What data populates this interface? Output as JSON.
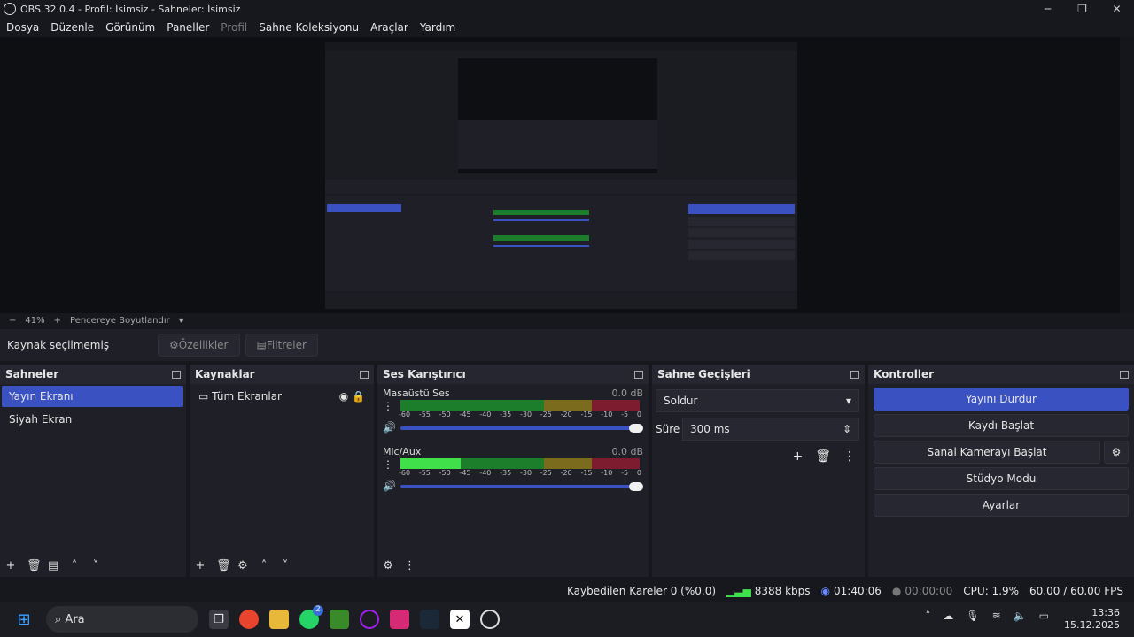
{
  "window": {
    "title": "OBS 32.0.4 - Profil: İsimsiz - Sahneler: İsimsiz",
    "controls": [
      "─",
      "❐",
      "✕"
    ]
  },
  "menu": [
    {
      "label": "Dosya",
      "enabled": true
    },
    {
      "label": "Düzenle",
      "enabled": true
    },
    {
      "label": "Görünüm",
      "enabled": true
    },
    {
      "label": "Paneller",
      "enabled": true
    },
    {
      "label": "Profil",
      "enabled": false
    },
    {
      "label": "Sahne Koleksiyonu",
      "enabled": true
    },
    {
      "label": "Araçlar",
      "enabled": true
    },
    {
      "label": "Yardım",
      "enabled": true
    }
  ],
  "zoom": {
    "minus": "−",
    "value": "41%",
    "plus": "+",
    "fit": "Pencereye Boyutlandır",
    "arrow": "▾"
  },
  "source_bar": {
    "label": "Kaynak seçilmemiş",
    "properties": "Özellikler",
    "filters": "Filtreler",
    "properties_icon": "⚙",
    "filters_icon": "▤"
  },
  "scenes": {
    "title": "Sahneler",
    "items": [
      {
        "label": "Yayın Ekranı",
        "selected": true
      },
      {
        "label": "Siyah Ekran",
        "selected": false
      }
    ]
  },
  "sources": {
    "title": "Kaynaklar",
    "items": [
      {
        "label": "Tüm Ekranlar",
        "icon": "monitor-icon"
      }
    ]
  },
  "mixer": {
    "title": "Ses Karıştırıcı",
    "channels": [
      {
        "name": "Masaüstü Ses",
        "db": "0.0 dB",
        "level": 0
      },
      {
        "name": "Mic/Aux",
        "db": "0.0 dB",
        "level": 0.25
      }
    ],
    "ticks": [
      "-60",
      "-55",
      "-50",
      "-45",
      "-40",
      "-35",
      "-30",
      "-25",
      "-20",
      "-15",
      "-10",
      "-5",
      "0"
    ]
  },
  "transitions": {
    "title": "Sahne Geçişleri",
    "selected": "Soldur",
    "duration_label": "Süre",
    "duration": "300 ms"
  },
  "controls": {
    "title": "Kontroller",
    "stop_stream": "Yayını Durdur",
    "start_record": "Kaydı Başlat",
    "start_vcam": "Sanal Kamerayı Başlat",
    "studio_mode": "Stüdyo Modu",
    "settings": "Ayarlar"
  },
  "status": {
    "dropped": "Kaybedilen Kareler 0 (%0.0)",
    "bitrate": "8388 kbps",
    "stream_time": "01:40:06",
    "rec_time": "00:00:00",
    "cpu": "CPU: 1.9%",
    "fps": "60.00 / 60.00 FPS"
  },
  "taskbar": {
    "search": "Ara",
    "time": "13:36",
    "date": "15.12.2025",
    "badge": "2"
  },
  "colors": {
    "accent": "#3a51c2",
    "bg": "#17181e",
    "panel": "#1f2027"
  }
}
